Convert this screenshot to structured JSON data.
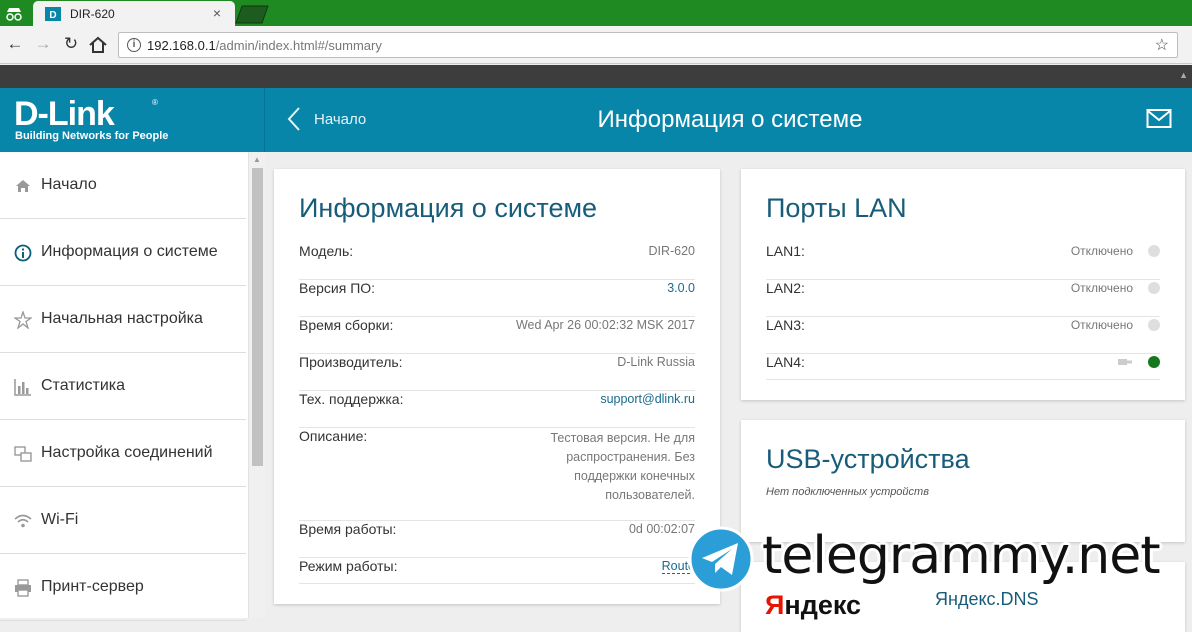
{
  "browser": {
    "tab_title": "DIR-620",
    "tab_close": "×",
    "url_host": "192.168.0.1",
    "url_path": "/admin/index.html#/summary"
  },
  "header": {
    "logo_main": "D-Link",
    "logo_registered": "®",
    "logo_tagline": "Building Networks for People",
    "back_label": "Начало",
    "title": "Информация о системе"
  },
  "sidebar": {
    "items": [
      {
        "label": "Начало",
        "icon": "home-icon"
      },
      {
        "label": "Информация о системе",
        "icon": "info-icon"
      },
      {
        "label": "Начальная настройка",
        "icon": "wizard-icon"
      },
      {
        "label": "Статистика",
        "icon": "statistics-icon"
      },
      {
        "label": "Настройка соединений",
        "icon": "connections-icon"
      },
      {
        "label": "Wi-Fi",
        "icon": "wifi-icon"
      },
      {
        "label": "Принт-сервер",
        "icon": "printer-icon"
      }
    ]
  },
  "system_info": {
    "title": "Информация о системе",
    "rows": [
      {
        "label": "Модель:",
        "value": "DIR-620"
      },
      {
        "label": "Версия ПО:",
        "value": "3.0.0"
      },
      {
        "label": "Время сборки:",
        "value": "Wed Apr 26 00:02:32 MSK 2017"
      },
      {
        "label": "Производитель:",
        "value": "D-Link Russia"
      },
      {
        "label": "Тех. поддержка:",
        "value": "support@dlink.ru"
      },
      {
        "label": "Описание:",
        "value": "Тестовая версия. Не для распространения. Без поддержки конечных пользователей."
      },
      {
        "label": "Время работы:",
        "value": "0d 00:02:07"
      },
      {
        "label": "Режим работы:",
        "value": "Route"
      }
    ]
  },
  "lan_ports": {
    "title": "Порты LAN",
    "ports": [
      {
        "label": "LAN1:",
        "status": "Отключено",
        "connected": false
      },
      {
        "label": "LAN2:",
        "status": "Отключено",
        "connected": false
      },
      {
        "label": "LAN3:",
        "status": "Отключено",
        "connected": false
      },
      {
        "label": "LAN4:",
        "status": "",
        "connected": true
      }
    ]
  },
  "usb": {
    "title": "USB-устройства",
    "empty_text": "Нет подключенных устройств"
  },
  "yandex": {
    "logo_first": "Я",
    "logo_rest": "ндекс",
    "title": "Яндекс.DNS"
  },
  "watermark": {
    "text": "telegrammy.net"
  },
  "colors": {
    "header_bg": "#0886a9",
    "title_text": "#175c7a",
    "chrome_frame": "#1f8a22",
    "port_connected": "#15781f"
  }
}
